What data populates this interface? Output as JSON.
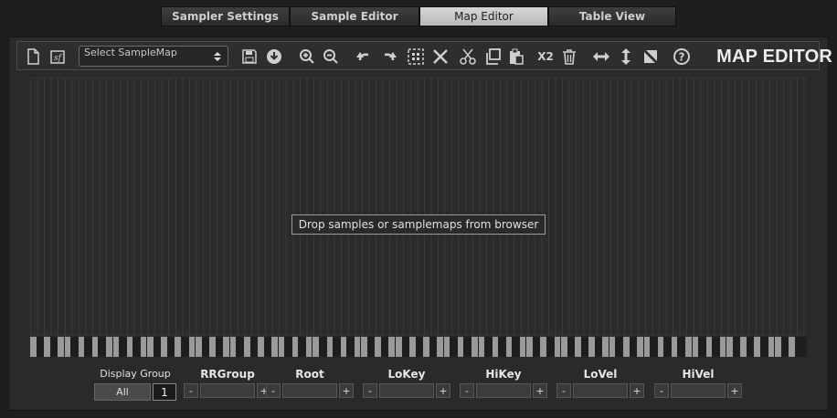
{
  "tabs": [
    {
      "label": "Sampler Settings",
      "active": false
    },
    {
      "label": "Sample Editor",
      "active": false
    },
    {
      "label": "Map Editor",
      "active": true
    },
    {
      "label": "Table View",
      "active": false
    }
  ],
  "toolbar": {
    "samplemap_placeholder": "Select SampleMap",
    "title": "MAP EDITOR",
    "icons": [
      "new-file-icon",
      "script-icon",
      "save-icon",
      "download-icon",
      "zoom-in-icon",
      "zoom-out-icon",
      "undo-icon",
      "redo-icon",
      "select-all-icon",
      "delete-x-icon",
      "cut-icon",
      "copy-icon",
      "paste-icon",
      "duplicate-x2-icon",
      "trash-icon",
      "fill-horizontal-icon",
      "fill-vertical-icon",
      "fill-diagonal-icon",
      "help-icon"
    ],
    "x2_label": "X2"
  },
  "map": {
    "drop_hint": "Drop samples or samplemaps from browser",
    "accent_color": "#9a9a9a"
  },
  "display_group": {
    "label": "Display Group",
    "all_label": "All",
    "value": "1"
  },
  "properties": [
    {
      "label": "RRGroup"
    },
    {
      "label": "Root"
    },
    {
      "label": "LoKey"
    },
    {
      "label": "HiKey"
    },
    {
      "label": "LoVel"
    },
    {
      "label": "HiVel"
    }
  ],
  "stepper": {
    "minus": "-",
    "plus": "+"
  }
}
